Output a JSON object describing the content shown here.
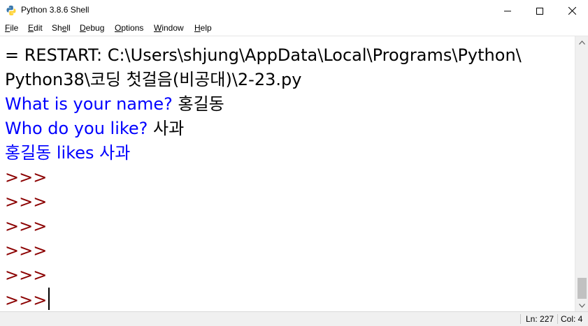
{
  "window": {
    "title": "Python 3.8.6 Shell",
    "controls": [
      "minimize",
      "maximize",
      "close"
    ]
  },
  "menubar": {
    "items": [
      {
        "label": "File",
        "accel": "F"
      },
      {
        "label": "Edit",
        "accel": "E"
      },
      {
        "label": "Shell",
        "accel": "e"
      },
      {
        "label": "Debug",
        "accel": "D"
      },
      {
        "label": "Options",
        "accel": "O"
      },
      {
        "label": "Window",
        "accel": "W"
      },
      {
        "label": "Help",
        "accel": "H"
      }
    ]
  },
  "shell": {
    "restart_line_1": "= RESTART: C:\\Users\\shjung\\AppData\\Local\\Programs\\Python\\",
    "restart_line_2": "Python38\\코딩 첫걸음(비공대)\\2-23.py",
    "prompt1": "What is your name? ",
    "answer1": "홍길동",
    "prompt2": "Who do you like? ",
    "answer2": "사과",
    "output": "홍길동 likes 사과",
    "prompt_symbol": ">>>",
    "prompt_count": 6
  },
  "statusbar": {
    "ln": "Ln: 227",
    "col": "Col: 4"
  },
  "colors": {
    "stdout": "#0000ff",
    "prompt": "#8b0000",
    "text": "#000000"
  }
}
